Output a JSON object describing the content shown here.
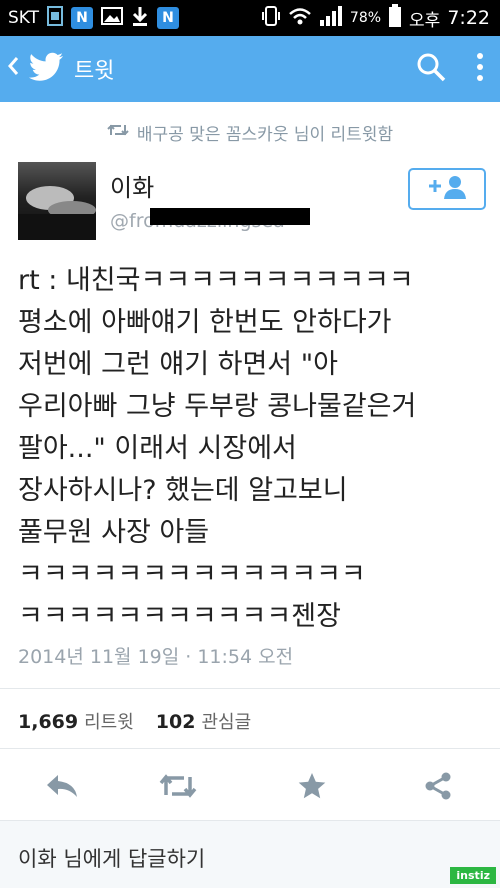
{
  "status_bar": {
    "carrier": "SKT",
    "battery": "78%",
    "ampm": "오후",
    "time": "7:22",
    "icons": [
      "sim-icon",
      "naver-icon",
      "gallery-icon",
      "download-icon",
      "naver-icon",
      "vibrate-icon",
      "wifi-icon",
      "signal-icon",
      "battery-icon"
    ]
  },
  "app_bar": {
    "title": "트윗",
    "icons": [
      "back-icon",
      "twitter-bird-icon",
      "search-icon",
      "overflow-menu-icon"
    ],
    "color": "#55acee"
  },
  "retweet_notice": {
    "text": "배구공 맞은 꼼스카웃 님이 리트윗함",
    "icon": "retweet-icon"
  },
  "author": {
    "name": "이화",
    "handle": "@fromdazzlingsea"
  },
  "follow_button": {
    "icon": "follow-user-icon"
  },
  "tweet": {
    "lines": [
      "rt : 내친국ㅋㅋㅋㅋㅋㅋㅋㅋㅋㅋㅋ",
      "평소에 아빠얘기 한번도 안하다가",
      "저번에 그런 얘기 하면서 \"아",
      "우리아빠 그냥 두부랑 콩나물같은거",
      "팔아...\" 이래서 시장에서",
      "장사하시나? 했는데 알고보니",
      "풀무원 사장 아들",
      "ㅋㅋㅋㅋㅋㅋㅋㅋㅋㅋㅋㅋㅋㅋ",
      "ㅋㅋㅋㅋㅋㅋㅋㅋㅋㅋㅋ젠장"
    ]
  },
  "timestamp": "2014년 11월 19일 · 11:54 오전",
  "stats": {
    "retweets_count": "1,669",
    "retweets_label": "리트윗",
    "favorites_count": "102",
    "favorites_label": "관심글"
  },
  "actions": [
    "reply-icon",
    "retweet-icon",
    "favorite-star-icon",
    "share-icon"
  ],
  "reply_box": {
    "placeholder": "이화 님에게 답글하기"
  },
  "watermark": "instiz"
}
